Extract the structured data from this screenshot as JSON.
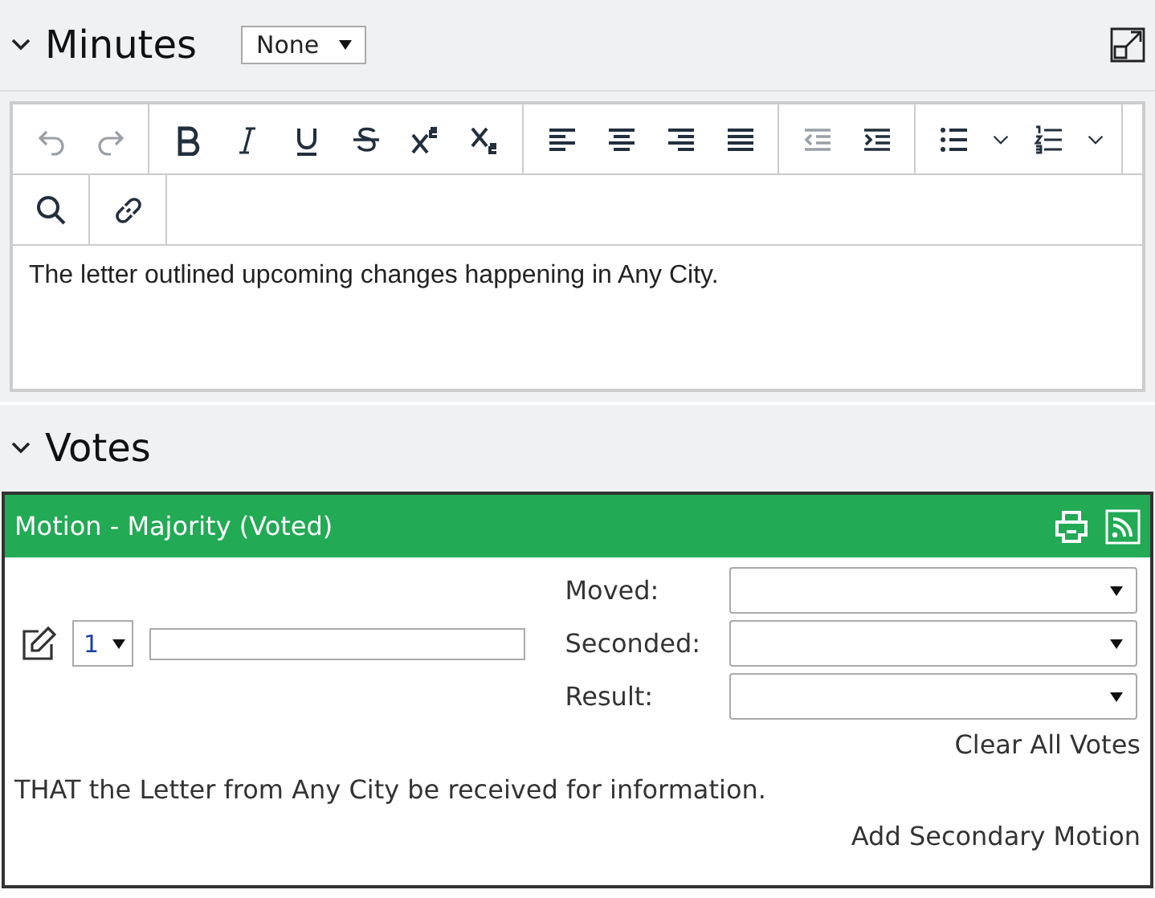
{
  "minutes": {
    "title": "Minutes",
    "expanded": true,
    "format_select": {
      "value": "None"
    }
  },
  "editor": {
    "toolbar_rows": [
      [
        [
          {
            "kind": "undo",
            "disabled": true
          },
          {
            "kind": "redo",
            "disabled": true
          }
        ],
        [
          {
            "kind": "bold",
            "disabled": false
          },
          {
            "kind": "italic",
            "disabled": false
          },
          {
            "kind": "underline",
            "disabled": false
          },
          {
            "kind": "strikethrough",
            "disabled": false
          },
          {
            "kind": "superscript",
            "disabled": false
          },
          {
            "kind": "subscript",
            "disabled": false
          }
        ],
        [
          {
            "kind": "align-left",
            "disabled": false
          },
          {
            "kind": "align-center",
            "disabled": false
          },
          {
            "kind": "align-right",
            "disabled": false
          },
          {
            "kind": "justify",
            "disabled": false
          }
        ],
        [
          {
            "kind": "outdent",
            "disabled": true
          },
          {
            "kind": "indent",
            "disabled": false
          }
        ],
        [
          {
            "kind": "bullet-list",
            "disabled": false
          },
          {
            "kind": "dropdown",
            "disabled": false
          },
          {
            "kind": "numbered-list",
            "disabled": false
          },
          {
            "kind": "dropdown",
            "disabled": false
          }
        ]
      ],
      [
        [
          {
            "kind": "search",
            "disabled": false
          }
        ],
        [
          {
            "kind": "link",
            "disabled": false
          }
        ]
      ]
    ],
    "content": "The letter outlined upcoming changes happening in Any City."
  },
  "votes": {
    "title": "Votes",
    "expanded": true
  },
  "motion": {
    "title": "Motion - Majority (Voted)",
    "number_select": {
      "value": "1"
    },
    "fields": [
      {
        "label": "Moved:"
      },
      {
        "label": "Seconded:"
      },
      {
        "label": "Result:"
      }
    ],
    "clear_link": "Clear All Votes",
    "text": "THAT the Letter from Any City be received for information.",
    "add_link": "Add Secondary Motion"
  }
}
